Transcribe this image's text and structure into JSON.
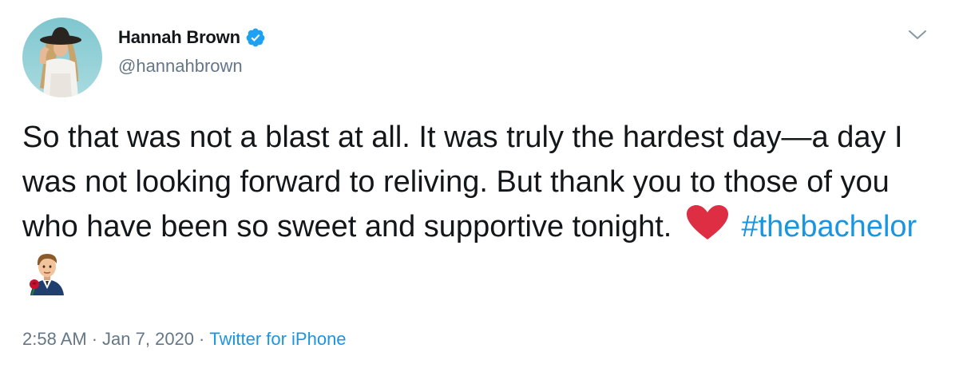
{
  "author": {
    "display_name": "Hannah Brown",
    "handle": "@hannahbrown",
    "verified": true,
    "verified_color": "#1da1f2"
  },
  "tweet": {
    "text_before": "So that was not a blast at all. It was truly the hardest day—a day I was not looking forward to reliving. But thank you to those of you who have been so sweet and supportive tonight.",
    "emoji_heart": "red-heart",
    "hashtag": "#thebachelor",
    "hashtag_emoji": "bachelor-rose-emoji",
    "hashtag_color": "#1b95e0"
  },
  "meta": {
    "time": "2:58 AM",
    "separator_1": "·",
    "date": "Jan 7, 2020",
    "separator_2": "·",
    "source": "Twitter for iPhone"
  },
  "icons": {
    "caret": "chevron-down-icon",
    "verified": "verified-badge-icon"
  }
}
